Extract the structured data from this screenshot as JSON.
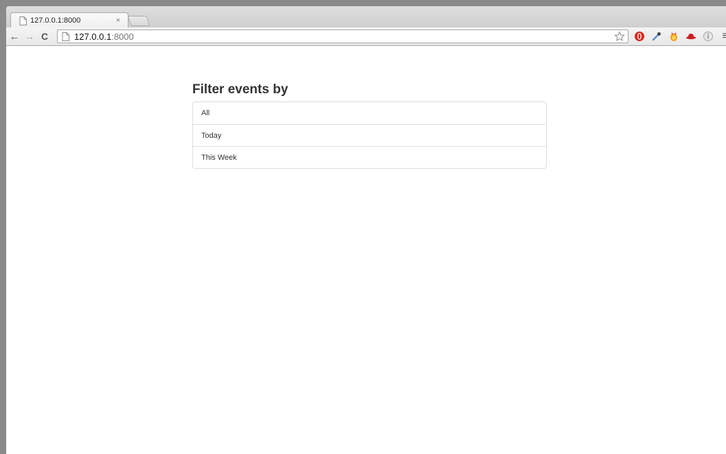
{
  "tab": {
    "title": "127.0.0.1:8000",
    "close_glyph": "×"
  },
  "toolbar": {
    "back_glyph": "←",
    "forward_glyph": "→",
    "reload_glyph": "C",
    "url_host": "127.0.0.1",
    "url_port": ":8000",
    "menu_glyph": "≡"
  },
  "extensions": [
    "star-icon",
    "opera-icon",
    "eyedropper-icon",
    "firebug-icon",
    "redhat-icon",
    "info-icon",
    "menu-icon"
  ],
  "page": {
    "heading": "Filter events by",
    "filters": [
      "All",
      "Today",
      "This Week"
    ]
  }
}
